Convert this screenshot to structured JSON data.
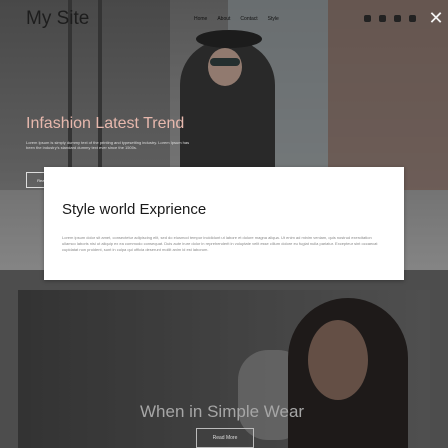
{
  "header": {
    "site_title": "My Site",
    "nav": [
      "Home",
      "About",
      "Contact",
      "Style"
    ],
    "social_icons": [
      "facebook-icon",
      "instagram-icon",
      "pinterest-icon",
      "twitter-icon"
    ],
    "close_symbol": "✕"
  },
  "hero": {
    "heading": "Infashion Latest Trend",
    "subtext": "Lorem Ipsum is simply dummy text of the printing and typesetting industry. Lorem Ipsum has been the industry's standard dummy text ever since the 1500s.",
    "button": "Read More"
  },
  "modal": {
    "title": "Style world Exprience",
    "body": "Lorem ipsum dolor sit amet, consectetur adipiscing elit, sed do eiusmod tempor incididunt ut labore et dolore magna aliqua. Ut enim ad minim veniam, quis nostrud exercitation ullamco laboris nisi ut aliquip ex ea commodo consequat. Duis aute irure dolor in reprehenderit in voluptate velit esse cillum dolore eu fugiat nulla pariatur. Excepteur sint occaecat cupidatat non proident, sunt in culpa qui officia deserunt mollit anim id est laborum."
  },
  "lower": {
    "heading": "When in Simple Wear",
    "button": "Read More"
  }
}
